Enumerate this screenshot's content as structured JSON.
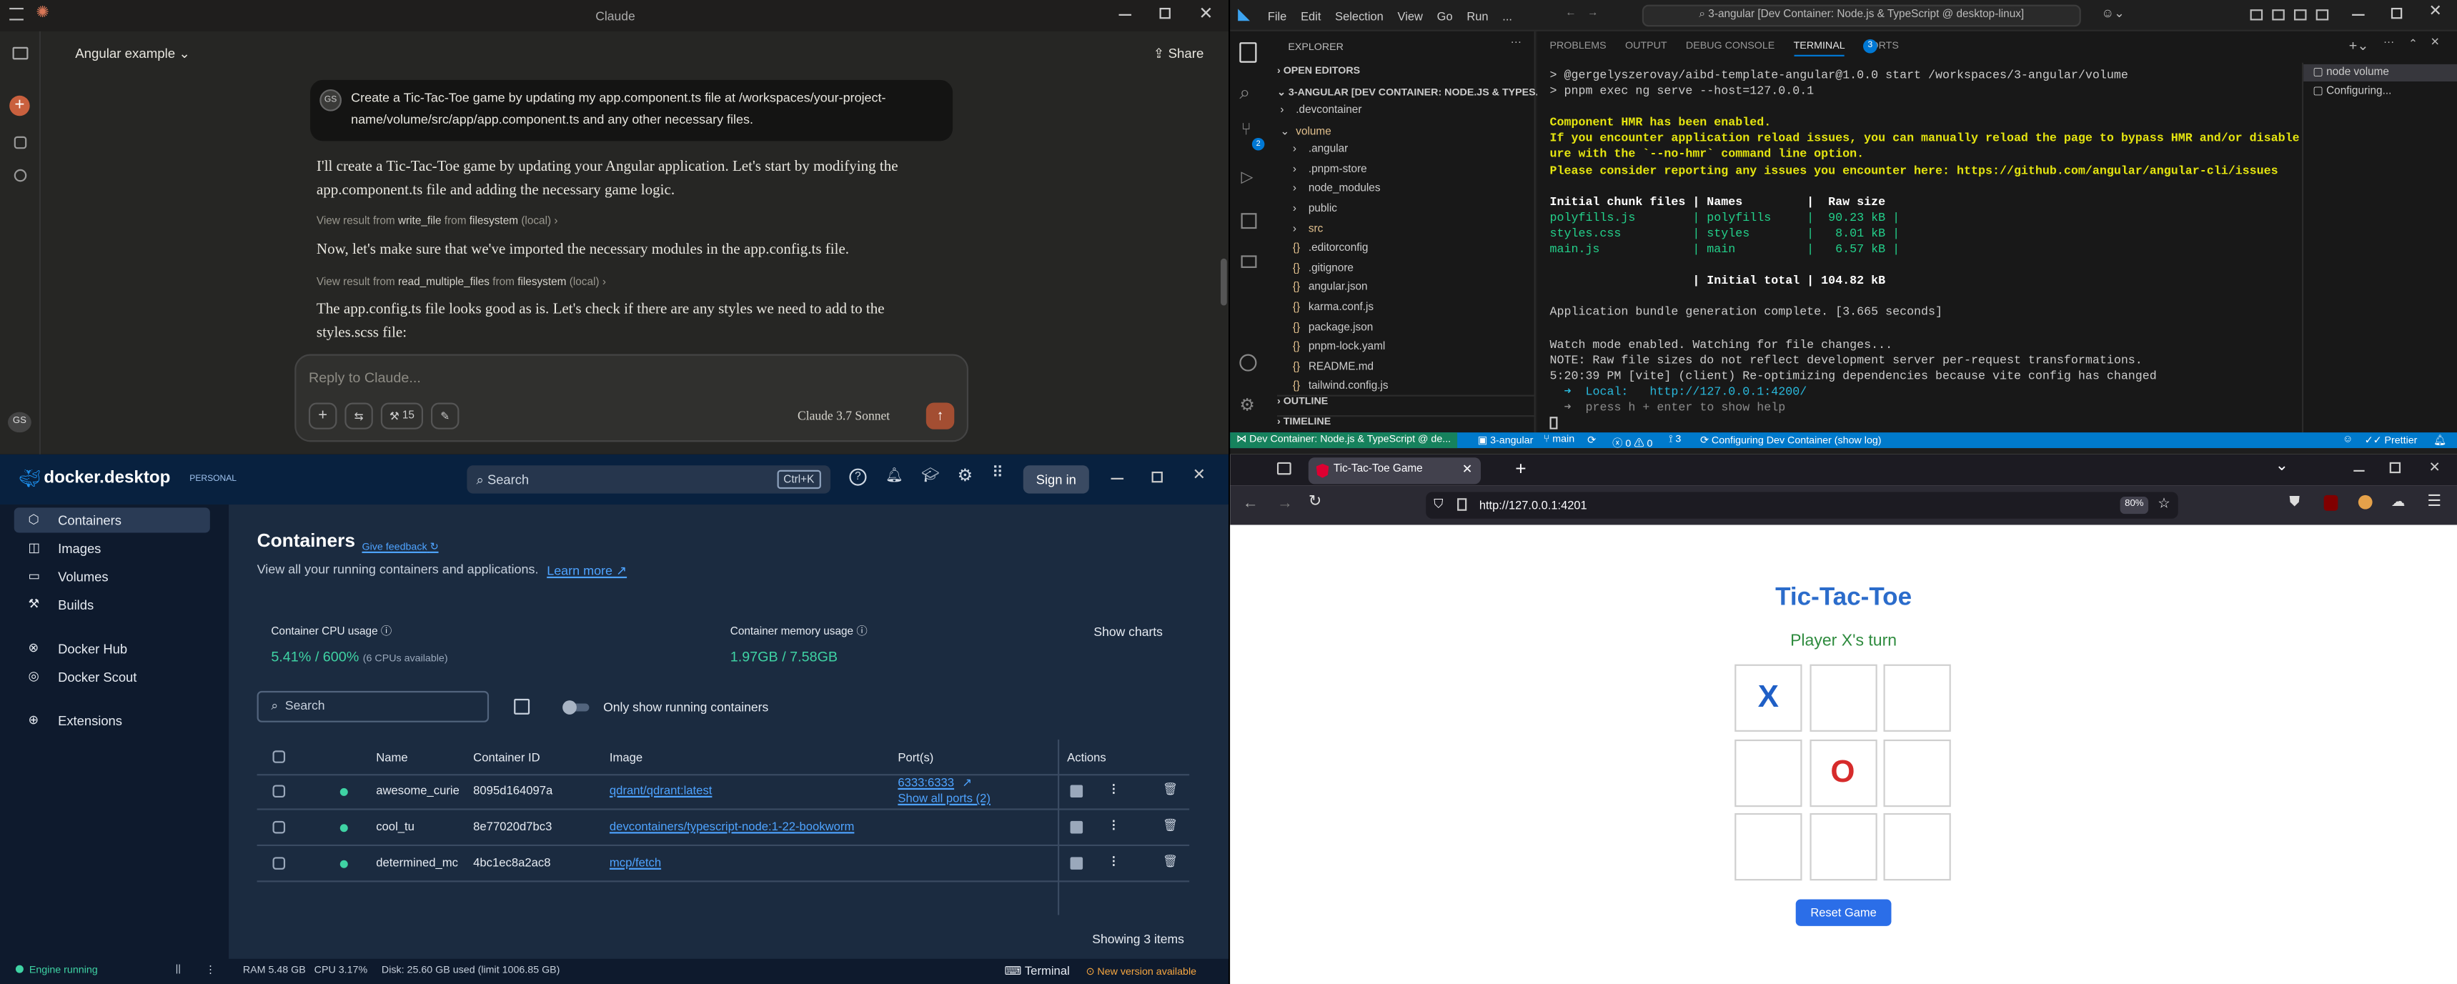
{
  "claude": {
    "window_title": "Claude",
    "project": "Angular example",
    "share": "Share",
    "avatar": "GS",
    "user_message": "Create a Tic-Tac-Toe game by updating my app.component.ts file at /workspaces/your-project-name/volume/src/app/app.component.ts and any other necessary files.",
    "p1": "I'll create a Tic-Tac-Toe game by updating your Angular application. Let's start by modifying the app.component.ts file and adding the necessary game logic.",
    "tool1": {
      "pre": "View result from",
      "tool": "write_file",
      "mid": "from",
      "src": "filesystem",
      "suf": "(local)"
    },
    "p2": "Now, let's make sure that we've imported the necessary modules in the app.config.ts file.",
    "tool2": {
      "pre": "View result from",
      "tool": "read_multiple_files",
      "mid": "from",
      "src": "filesystem",
      "suf": "(local)"
    },
    "p3": "The app.config.ts file looks good as is. Let's check if there are any styles we need to add to the styles.scss file:",
    "placeholder": "Reply to Claude...",
    "tools_count": "15",
    "model": "Claude 3.7 Sonnet"
  },
  "vscode": {
    "menu": [
      "File",
      "Edit",
      "Selection",
      "View",
      "Go",
      "Run",
      "..."
    ],
    "command_center": "3-angular [Dev Container: Node.js & TypeScript @ desktop-linux]",
    "explorer_title": "EXPLORER",
    "open_editors": "OPEN EDITORS",
    "workspace": "3-ANGULAR [DEV CONTAINER: NODE.JS & TYPES...",
    "tree": [
      {
        "label": ".devcontainer",
        "kind": "folder",
        "indent": 1
      },
      {
        "label": "volume",
        "kind": "folder-open",
        "indent": 1
      },
      {
        "label": ".angular",
        "kind": "folder",
        "indent": 2
      },
      {
        "label": ".pnpm-store",
        "kind": "folder",
        "indent": 2
      },
      {
        "label": "node_modules",
        "kind": "folder",
        "indent": 2
      },
      {
        "label": "public",
        "kind": "folder",
        "indent": 2
      },
      {
        "label": "src",
        "kind": "folder",
        "indent": 2
      },
      {
        "label": ".editorconfig",
        "kind": "file",
        "indent": 2
      },
      {
        "label": ".gitignore",
        "kind": "file",
        "indent": 2
      },
      {
        "label": "angular.json",
        "kind": "file",
        "indent": 2
      },
      {
        "label": "karma.conf.js",
        "kind": "file",
        "indent": 2
      },
      {
        "label": "package.json",
        "kind": "file",
        "indent": 2
      },
      {
        "label": "pnpm-lock.yaml",
        "kind": "file",
        "indent": 2
      },
      {
        "label": "README.md",
        "kind": "file",
        "indent": 2
      },
      {
        "label": "tailwind.config.js",
        "kind": "file",
        "indent": 2
      }
    ],
    "outline": "OUTLINE",
    "timeline": "TIMELINE",
    "panel_tabs": [
      "PROBLEMS",
      "OUTPUT",
      "DEBUG CONSOLE",
      "TERMINAL",
      "PORTS"
    ],
    "ports_count": "3",
    "terminal_list": [
      "node volume",
      "Configuring..."
    ],
    "terminal": [
      {
        "t": "> @gergelyszerovay/aibd-template-angular@1.0.0 start /workspaces/3-angular/volume",
        "c": "#cccccc"
      },
      {
        "t": "> pnpm exec ng serve --host=127.0.0.1",
        "c": "#cccccc"
      },
      {
        "t": "",
        "c": "#cccccc"
      },
      {
        "t": "Component HMR has been enabled.",
        "c": "#e5e510",
        "b": true
      },
      {
        "t": "If you encounter application reload issues, you can manually reload the page to bypass HMR and/or disable this feat",
        "c": "#e5e510",
        "b": true
      },
      {
        "t": "ure with the `--no-hmr` command line option.",
        "c": "#e5e510",
        "b": true
      },
      {
        "t": "Please consider reporting any issues you encounter here: https://github.com/angular/angular-cli/issues",
        "c": "#e5e510",
        "b": true
      },
      {
        "t": "",
        "c": "#cccccc"
      },
      {
        "t": "Initial chunk files | Names         |  Raw size",
        "c": "#ffffff",
        "b": true
      },
      {
        "t": "polyfills.js        | polyfills     |  90.23 kB |",
        "c": "#23d18b"
      },
      {
        "t": "styles.css          | styles        |   8.01 kB |",
        "c": "#23d18b"
      },
      {
        "t": "main.js             | main          |   6.57 kB |",
        "c": "#23d18b"
      },
      {
        "t": "",
        "c": "#cccccc"
      },
      {
        "t": "                    | Initial total | 104.82 kB",
        "c": "#ffffff",
        "b": true
      },
      {
        "t": "",
        "c": "#cccccc"
      },
      {
        "t": "Application bundle generation complete. [3.665 seconds]",
        "c": "#cccccc"
      },
      {
        "t": "",
        "c": "#cccccc"
      },
      {
        "t": "Watch mode enabled. Watching for file changes...",
        "c": "#cccccc"
      },
      {
        "t": "NOTE: Raw file sizes do not reflect development server per-request transformations.",
        "c": "#cccccc"
      },
      {
        "t": "5:20:39 PM [vite] (client) Re-optimizing dependencies because vite config has changed",
        "c": "#cccccc"
      },
      {
        "t": "  ➜  Local:   http://127.0.0.1:4200/",
        "c": "#29b8db"
      },
      {
        "t": "  ➜  press h + enter to show help",
        "c": "#8a8a8a"
      }
    ],
    "status": {
      "remote": "Dev Container: Node.js & TypeScript @ de...",
      "folder": "3-angular",
      "branch": "main",
      "errors": "0",
      "warnings": "0",
      "ports": "3",
      "task": "Configuring Dev Container (show log)",
      "prettier": "Prettier"
    }
  },
  "docker": {
    "brand": "docker.desktop",
    "plan": "PERSONAL",
    "search": "Search",
    "shortcut": "Ctrl+K",
    "signin": "Sign in",
    "nav": [
      "Containers",
      "Images",
      "Volumes",
      "Builds",
      "Docker Hub",
      "Docker Scout",
      "Extensions"
    ],
    "title": "Containers",
    "feedback": "Give feedback",
    "subtitle": "View all your running containers and applications.",
    "learn_more": "Learn more",
    "cpu_label": "Container CPU usage",
    "cpu_value": "5.41%",
    "cpu_total": "/ 600%",
    "cpu_note": "(6 CPUs available)",
    "mem_label": "Container memory usage",
    "mem_value": "1.97GB",
    "mem_total": "/ 7.58GB",
    "show_charts": "Show charts",
    "search_placeholder": "Search",
    "only_running": "Only show running containers",
    "headers": [
      "Name",
      "Container ID",
      "Image",
      "Port(s)",
      "Actions"
    ],
    "rows": [
      {
        "name": "awesome_curie",
        "id": "8095d164097a",
        "image": "qdrant/qdrant:latest",
        "port": "6333:6333",
        "port2": "Show all ports (2)"
      },
      {
        "name": "cool_tu",
        "id": "8e77020d7bc3",
        "image": "devcontainers/typescript-node:1-22-bookworm",
        "port": "",
        "port2": ""
      },
      {
        "name": "determined_mc",
        "id": "4bc1ec8a2ac8",
        "image": "mcp/fetch",
        "port": "",
        "port2": ""
      }
    ],
    "showing": "Showing 3 items",
    "engine": "Engine running",
    "stats": "RAM 5.48 GB   CPU 3.17%     Disk: 25.60 GB used (limit 1006.85 GB)",
    "terminal": "Terminal",
    "new_version": "New version available"
  },
  "firefox": {
    "tab_title": "Tic-Tac-Toe Game",
    "url": "http://127.0.0.1:4201",
    "zoom": "80%",
    "game": {
      "title": "Tic-Tac-Toe",
      "status": "Player X's turn",
      "board": [
        "X",
        "",
        "",
        "",
        "O",
        "",
        "",
        "",
        ""
      ],
      "reset": "Reset Game"
    }
  }
}
